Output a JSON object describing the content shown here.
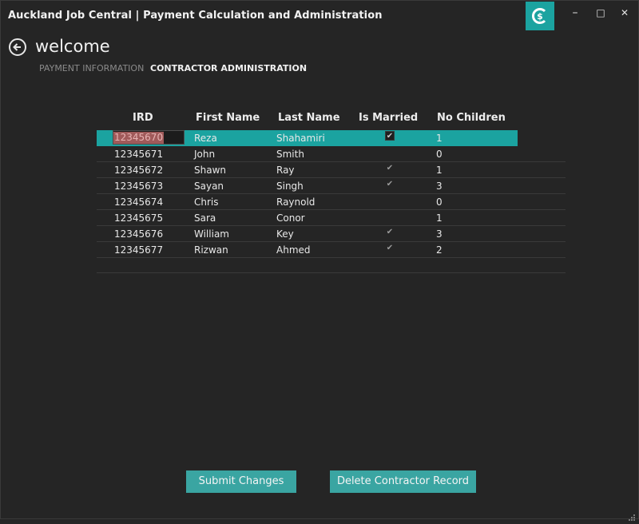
{
  "window": {
    "title": "Auckland Job Central | Payment Calculation and Administration",
    "logo_icon": "dollar-circle-icon",
    "accent": "#1ba3a0",
    "controls": {
      "minimize": "–",
      "maximize": "□",
      "close": "✕"
    }
  },
  "header": {
    "title": "welcome"
  },
  "tabs": [
    {
      "label": "PAYMENT INFORMATION",
      "active": false
    },
    {
      "label": "CONTRACTOR ADMINISTRATION",
      "active": true
    }
  ],
  "grid": {
    "columns": [
      "IRD",
      "First Name",
      "Last Name",
      "Is Married",
      "No Children"
    ],
    "rows": [
      {
        "ird": "12345670",
        "first": "Reza",
        "last": "Shahamiri",
        "married": true,
        "children": "1",
        "selected": true
      },
      {
        "ird": "12345671",
        "first": "John",
        "last": "Smith",
        "married": false,
        "children": "0"
      },
      {
        "ird": "12345672",
        "first": "Shawn",
        "last": "Ray",
        "married": true,
        "children": "1"
      },
      {
        "ird": "12345673",
        "first": "Sayan",
        "last": "Singh",
        "married": true,
        "children": "3"
      },
      {
        "ird": "12345674",
        "first": "Chris",
        "last": "Raynold",
        "married": false,
        "children": "0"
      },
      {
        "ird": "12345675",
        "first": "Sara",
        "last": "Conor",
        "married": false,
        "children": "1"
      },
      {
        "ird": "12345676",
        "first": "William",
        "last": "Key",
        "married": true,
        "children": "3"
      },
      {
        "ird": "12345677",
        "first": "Rizwan",
        "last": "Ahmed",
        "married": true,
        "children": "2"
      }
    ]
  },
  "actions": {
    "submit_label": "Submit Changes",
    "delete_label": "Delete Contractor Record"
  }
}
